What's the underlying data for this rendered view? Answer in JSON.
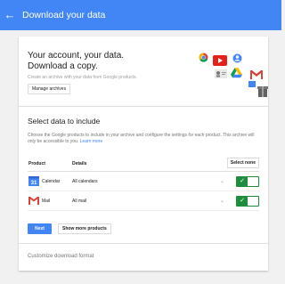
{
  "topbar": {
    "title": "Download your data",
    "back_icon": "arrow-left-icon",
    "color": "#4285f4"
  },
  "hero": {
    "title_line1": "Your account, your data.",
    "title_line2": "Download a copy.",
    "subtitle": "Create an archive with your data from Google products.",
    "manage_label": "Manage archives"
  },
  "select": {
    "title": "Select data to include",
    "description": "Choose the Google products to include in your archive and configure the settings for each product. This archive will only be accessible to you.",
    "learn_more": "Learn more",
    "columns": {
      "product": "Product",
      "details": "Details"
    },
    "select_none": "Select none",
    "rows": [
      {
        "icon": "calendar-icon",
        "name": "Calendar",
        "detail": "All calendars",
        "included": true
      },
      {
        "icon": "gmail-icon",
        "name": "Mail",
        "detail": "All mail",
        "included": true
      }
    ]
  },
  "actions": {
    "next": "Next",
    "more": "Show more products"
  },
  "customize": "Customize download format",
  "colors": {
    "accent": "#4285f4",
    "toggle": "#1e8e3e"
  }
}
